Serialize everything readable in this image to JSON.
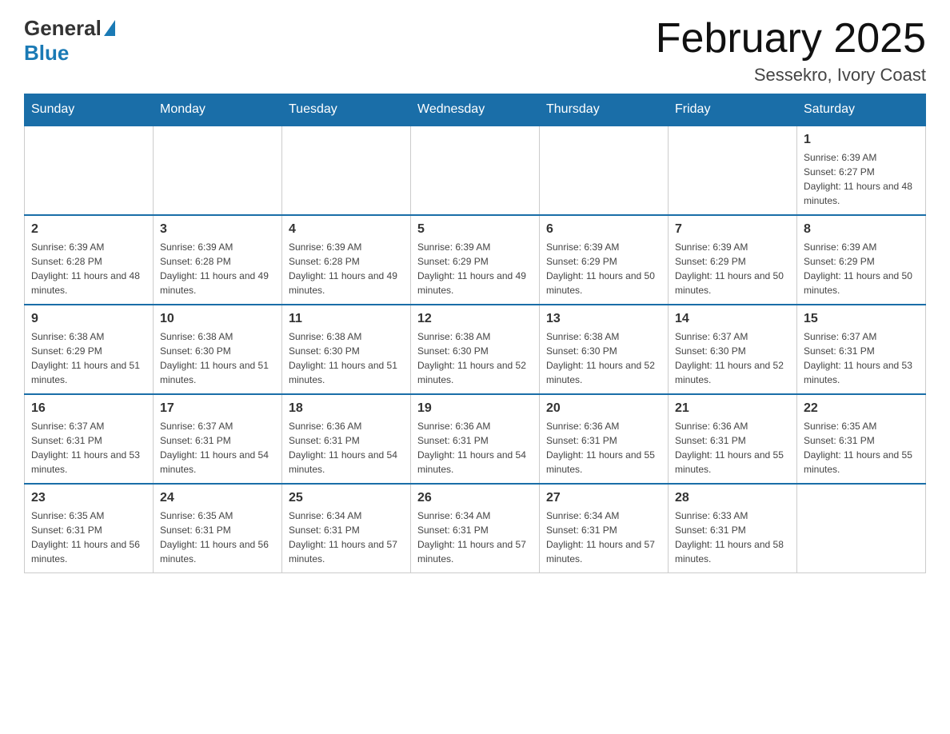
{
  "header": {
    "logo_general": "General",
    "logo_blue": "Blue",
    "title": "February 2025",
    "subtitle": "Sessekro, Ivory Coast"
  },
  "weekdays": [
    "Sunday",
    "Monday",
    "Tuesday",
    "Wednesday",
    "Thursday",
    "Friday",
    "Saturday"
  ],
  "weeks": [
    [
      {
        "day": "",
        "sunrise": "",
        "sunset": "",
        "daylight": ""
      },
      {
        "day": "",
        "sunrise": "",
        "sunset": "",
        "daylight": ""
      },
      {
        "day": "",
        "sunrise": "",
        "sunset": "",
        "daylight": ""
      },
      {
        "day": "",
        "sunrise": "",
        "sunset": "",
        "daylight": ""
      },
      {
        "day": "",
        "sunrise": "",
        "sunset": "",
        "daylight": ""
      },
      {
        "day": "",
        "sunrise": "",
        "sunset": "",
        "daylight": ""
      },
      {
        "day": "1",
        "sunrise": "Sunrise: 6:39 AM",
        "sunset": "Sunset: 6:27 PM",
        "daylight": "Daylight: 11 hours and 48 minutes."
      }
    ],
    [
      {
        "day": "2",
        "sunrise": "Sunrise: 6:39 AM",
        "sunset": "Sunset: 6:28 PM",
        "daylight": "Daylight: 11 hours and 48 minutes."
      },
      {
        "day": "3",
        "sunrise": "Sunrise: 6:39 AM",
        "sunset": "Sunset: 6:28 PM",
        "daylight": "Daylight: 11 hours and 49 minutes."
      },
      {
        "day": "4",
        "sunrise": "Sunrise: 6:39 AM",
        "sunset": "Sunset: 6:28 PM",
        "daylight": "Daylight: 11 hours and 49 minutes."
      },
      {
        "day": "5",
        "sunrise": "Sunrise: 6:39 AM",
        "sunset": "Sunset: 6:29 PM",
        "daylight": "Daylight: 11 hours and 49 minutes."
      },
      {
        "day": "6",
        "sunrise": "Sunrise: 6:39 AM",
        "sunset": "Sunset: 6:29 PM",
        "daylight": "Daylight: 11 hours and 50 minutes."
      },
      {
        "day": "7",
        "sunrise": "Sunrise: 6:39 AM",
        "sunset": "Sunset: 6:29 PM",
        "daylight": "Daylight: 11 hours and 50 minutes."
      },
      {
        "day": "8",
        "sunrise": "Sunrise: 6:39 AM",
        "sunset": "Sunset: 6:29 PM",
        "daylight": "Daylight: 11 hours and 50 minutes."
      }
    ],
    [
      {
        "day": "9",
        "sunrise": "Sunrise: 6:38 AM",
        "sunset": "Sunset: 6:29 PM",
        "daylight": "Daylight: 11 hours and 51 minutes."
      },
      {
        "day": "10",
        "sunrise": "Sunrise: 6:38 AM",
        "sunset": "Sunset: 6:30 PM",
        "daylight": "Daylight: 11 hours and 51 minutes."
      },
      {
        "day": "11",
        "sunrise": "Sunrise: 6:38 AM",
        "sunset": "Sunset: 6:30 PM",
        "daylight": "Daylight: 11 hours and 51 minutes."
      },
      {
        "day": "12",
        "sunrise": "Sunrise: 6:38 AM",
        "sunset": "Sunset: 6:30 PM",
        "daylight": "Daylight: 11 hours and 52 minutes."
      },
      {
        "day": "13",
        "sunrise": "Sunrise: 6:38 AM",
        "sunset": "Sunset: 6:30 PM",
        "daylight": "Daylight: 11 hours and 52 minutes."
      },
      {
        "day": "14",
        "sunrise": "Sunrise: 6:37 AM",
        "sunset": "Sunset: 6:30 PM",
        "daylight": "Daylight: 11 hours and 52 minutes."
      },
      {
        "day": "15",
        "sunrise": "Sunrise: 6:37 AM",
        "sunset": "Sunset: 6:31 PM",
        "daylight": "Daylight: 11 hours and 53 minutes."
      }
    ],
    [
      {
        "day": "16",
        "sunrise": "Sunrise: 6:37 AM",
        "sunset": "Sunset: 6:31 PM",
        "daylight": "Daylight: 11 hours and 53 minutes."
      },
      {
        "day": "17",
        "sunrise": "Sunrise: 6:37 AM",
        "sunset": "Sunset: 6:31 PM",
        "daylight": "Daylight: 11 hours and 54 minutes."
      },
      {
        "day": "18",
        "sunrise": "Sunrise: 6:36 AM",
        "sunset": "Sunset: 6:31 PM",
        "daylight": "Daylight: 11 hours and 54 minutes."
      },
      {
        "day": "19",
        "sunrise": "Sunrise: 6:36 AM",
        "sunset": "Sunset: 6:31 PM",
        "daylight": "Daylight: 11 hours and 54 minutes."
      },
      {
        "day": "20",
        "sunrise": "Sunrise: 6:36 AM",
        "sunset": "Sunset: 6:31 PM",
        "daylight": "Daylight: 11 hours and 55 minutes."
      },
      {
        "day": "21",
        "sunrise": "Sunrise: 6:36 AM",
        "sunset": "Sunset: 6:31 PM",
        "daylight": "Daylight: 11 hours and 55 minutes."
      },
      {
        "day": "22",
        "sunrise": "Sunrise: 6:35 AM",
        "sunset": "Sunset: 6:31 PM",
        "daylight": "Daylight: 11 hours and 55 minutes."
      }
    ],
    [
      {
        "day": "23",
        "sunrise": "Sunrise: 6:35 AM",
        "sunset": "Sunset: 6:31 PM",
        "daylight": "Daylight: 11 hours and 56 minutes."
      },
      {
        "day": "24",
        "sunrise": "Sunrise: 6:35 AM",
        "sunset": "Sunset: 6:31 PM",
        "daylight": "Daylight: 11 hours and 56 minutes."
      },
      {
        "day": "25",
        "sunrise": "Sunrise: 6:34 AM",
        "sunset": "Sunset: 6:31 PM",
        "daylight": "Daylight: 11 hours and 57 minutes."
      },
      {
        "day": "26",
        "sunrise": "Sunrise: 6:34 AM",
        "sunset": "Sunset: 6:31 PM",
        "daylight": "Daylight: 11 hours and 57 minutes."
      },
      {
        "day": "27",
        "sunrise": "Sunrise: 6:34 AM",
        "sunset": "Sunset: 6:31 PM",
        "daylight": "Daylight: 11 hours and 57 minutes."
      },
      {
        "day": "28",
        "sunrise": "Sunrise: 6:33 AM",
        "sunset": "Sunset: 6:31 PM",
        "daylight": "Daylight: 11 hours and 58 minutes."
      },
      {
        "day": "",
        "sunrise": "",
        "sunset": "",
        "daylight": ""
      }
    ]
  ]
}
